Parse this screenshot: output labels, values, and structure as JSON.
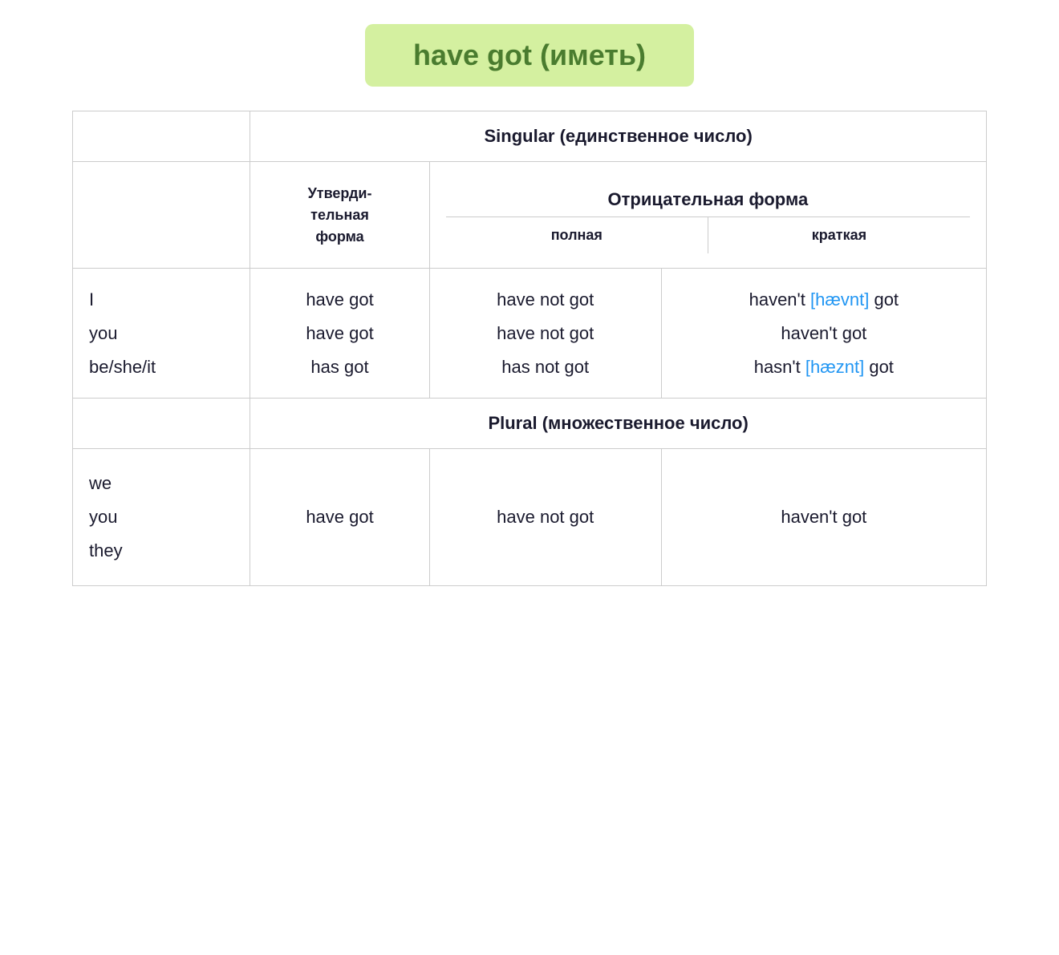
{
  "title": {
    "text": "have got (иметь)",
    "bg_color": "#d4f0a0",
    "text_color": "#4a7c2f"
  },
  "table": {
    "singular_header": "Singular (единственное число)",
    "plural_header": "Plural (множественное число)",
    "affirmative_header": "Утверди-\nтельная\nформа",
    "negative_header": "Отрицательная форма",
    "full_label": "полная",
    "short_label": "краткая",
    "singular_rows": [
      {
        "subject": "I\nyou\nbe/she/it",
        "affirmative": "have got\nhave got\nhas got",
        "negative_full": "have not got\nhave not got\nhas not got",
        "negative_short_1": "haven't",
        "phonetic_1": "[hævnt]",
        "negative_short_1_end": "got",
        "negative_short_2": "haven't got",
        "negative_short_3": "hasn't",
        "phonetic_3": "[hæznt]",
        "negative_short_3_end": "got"
      }
    ],
    "plural_rows": [
      {
        "subject": "we\nyou\nthey",
        "affirmative": "have got",
        "negative_full": "have not got",
        "negative_short": "haven't got"
      }
    ]
  }
}
